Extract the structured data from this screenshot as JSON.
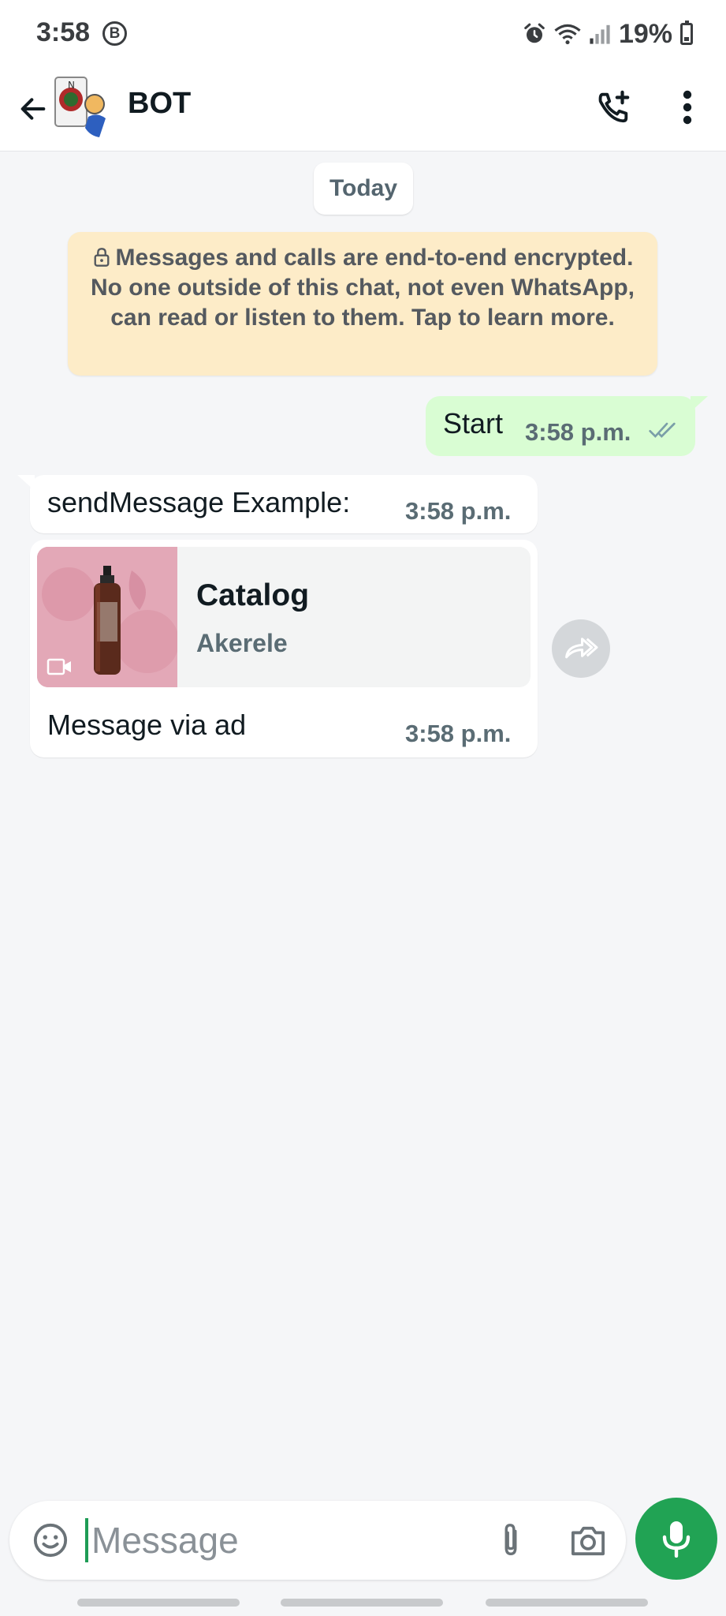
{
  "status_bar": {
    "time": "3:58",
    "carrier_badge": "B",
    "battery_percent": "19%",
    "icons": [
      "alarm-icon",
      "wifi-icon",
      "signal-icon",
      "battery-icon"
    ]
  },
  "header": {
    "contact_name": "BOT",
    "icons": [
      "back-arrow-icon",
      "add-call-icon",
      "more-vert-icon"
    ]
  },
  "chat": {
    "date_chip": "Today",
    "encryption_notice": "Messages and calls are end-to-end encrypted. No one outside of this chat, not even WhatsApp, can read or listen to them. Tap to learn more.",
    "messages": [
      {
        "direction": "outgoing",
        "text": "Start",
        "time": "3:58 p.m.",
        "status": "read"
      },
      {
        "direction": "incoming",
        "text": "sendMessage Example:",
        "time": "3:58 p.m."
      },
      {
        "direction": "incoming",
        "card": {
          "title": "Catalog",
          "subtitle": "Akerele",
          "thumbnail": "product-bottle-image"
        },
        "text": "Message via ad",
        "time": "3:58 p.m."
      }
    ]
  },
  "composer": {
    "placeholder": "Message",
    "value": "",
    "icons": [
      "emoji-icon",
      "attach-icon",
      "camera-icon",
      "mic-icon"
    ]
  },
  "colors": {
    "outgoing_bubble": "#d9fdd3",
    "incoming_bubble": "#ffffff",
    "encryption_banner": "#fdecc8",
    "accent_green": "#21a354",
    "chat_background": "#f5f6f8"
  }
}
